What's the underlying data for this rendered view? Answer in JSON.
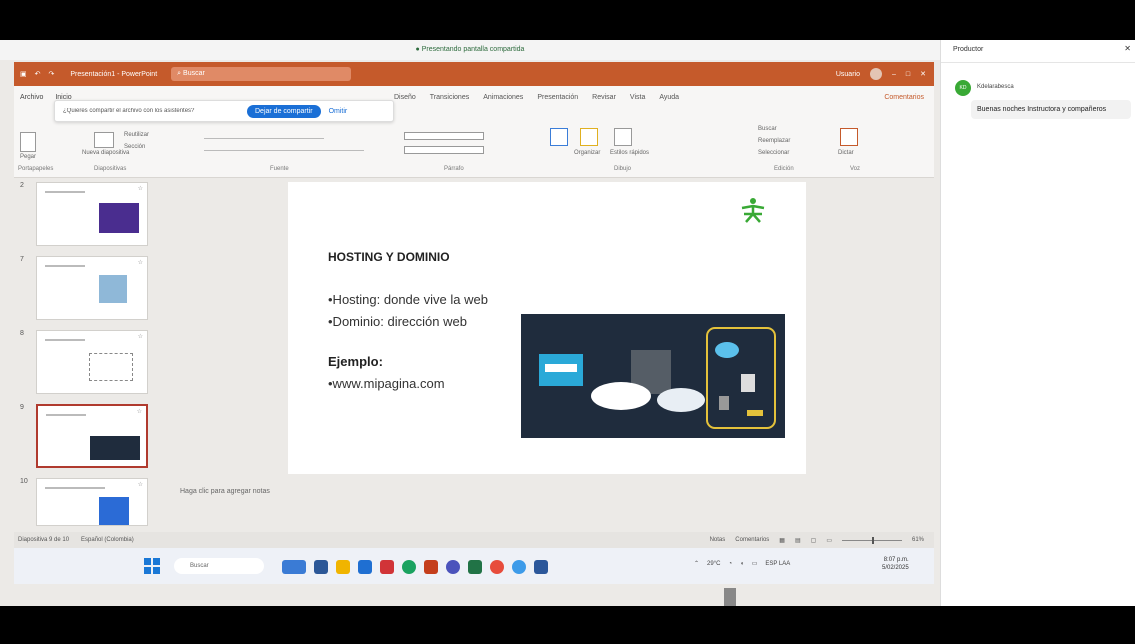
{
  "share_bar": {
    "text": "● Presentando pantalla compartida"
  },
  "titlebar": {
    "title": "Presentación1 - PowerPoint",
    "search_placeholder": "Buscar",
    "user": "Usuario"
  },
  "ribbon": {
    "tabs_left": [
      "Archivo",
      "Inicio"
    ],
    "tabs_right": [
      "Diseño",
      "Transiciones",
      "Animaciones",
      "Presentación",
      "Revisar",
      "Vista",
      "Ayuda"
    ],
    "comments_label": "Comentarios",
    "banner_text": "¿Quieres compartir el archivo con los asistentes?",
    "banner_button": "Dejar de compartir",
    "banner_link": "Omitir",
    "group_labels": [
      "Portapapeles",
      "Diapositivas",
      "Fuente",
      "Párrafo",
      "Dibujo",
      "Edición",
      "Voz"
    ],
    "buttons": {
      "paste": "Pegar",
      "new_slide": "Nueva diapositiva",
      "reuse": "Reutilizar",
      "section": "Sección",
      "arrange": "Organizar",
      "styles": "Estilos rápidos",
      "find": "Buscar",
      "replace": "Reemplazar",
      "select": "Seleccionar",
      "dictate": "Dictar"
    }
  },
  "thumbnails": [
    {
      "number": "2"
    },
    {
      "number": "7"
    },
    {
      "number": "8"
    },
    {
      "number": "9"
    },
    {
      "number": "10"
    }
  ],
  "slide": {
    "title": "HOSTING Y DOMINIO",
    "bullets": [
      "•Hosting: donde vive la web",
      "•Dominio: dirección web"
    ],
    "example_label": "Ejemplo:",
    "example_value": "•www.mipagina.com",
    "logo_icon": "sena-logo-icon",
    "accent": "#39a935"
  },
  "notes": {
    "placeholder": "Haga clic para agregar notas"
  },
  "status": {
    "slide_counter": "Diapositiva 9 de 10",
    "language": "Español (Colombia)",
    "notes_label": "Notas",
    "comments_label": "Comentarios",
    "zoom": "61%"
  },
  "taskbar": {
    "search_placeholder": "Buscar",
    "time": "8:07 p.m.",
    "date": "5/02/2025",
    "lang": "ESP LAA",
    "weather": "29°C"
  },
  "chat": {
    "header": "Productor",
    "sender": "Kdelarabesca",
    "avatar_initials": "KD",
    "message": "Buenas noches Instructora y compañeros"
  },
  "colors": {
    "titlebar": "#c55a2b",
    "button_blue": "#1a6fd6",
    "selected_border": "#b03a2e"
  }
}
